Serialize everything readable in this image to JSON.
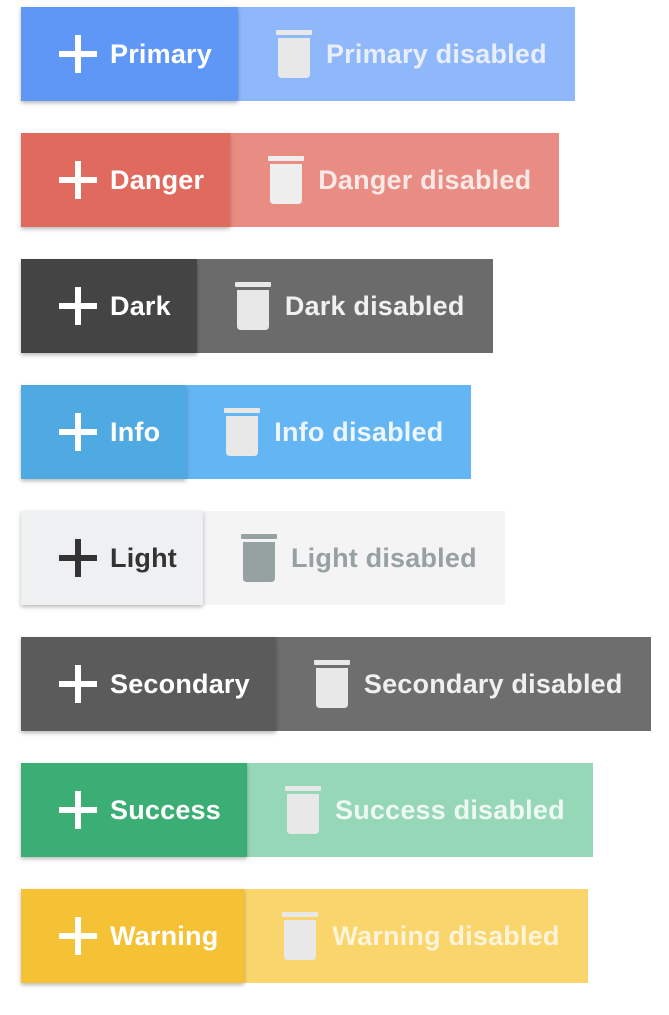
{
  "buttons": [
    {
      "id": "primary",
      "label": "Primary",
      "disabled_label": "Primary disabled",
      "colors": {
        "bg": "#5e97f6",
        "fg": "#ffffff",
        "disabled_bg": "#8fb8fa",
        "disabled_fg": "#e8eefb",
        "disabled_icon": "#e8e8e8"
      },
      "icon": "plus-icon",
      "disabled_icon": "trash-icon"
    },
    {
      "id": "danger",
      "label": "Danger",
      "disabled_label": "Danger disabled",
      "colors": {
        "bg": "#e06a5d",
        "fg": "#ffffff",
        "disabled_bg": "#e98c83",
        "disabled_fg": "#f8e9e7",
        "disabled_icon": "#eeeeee"
      },
      "icon": "plus-icon",
      "disabled_icon": "trash-icon"
    },
    {
      "id": "dark",
      "label": "Dark",
      "disabled_label": "Dark disabled",
      "colors": {
        "bg": "#444444",
        "fg": "#ffffff",
        "disabled_bg": "#6b6b6b",
        "disabled_fg": "#f0f0f0",
        "disabled_icon": "#e8e8e8"
      },
      "icon": "plus-icon",
      "disabled_icon": "trash-icon"
    },
    {
      "id": "info",
      "label": "Info",
      "disabled_label": "Info disabled",
      "colors": {
        "bg": "#4faae2",
        "fg": "#ffffff",
        "disabled_bg": "#64b5f3",
        "disabled_fg": "#eef6fd",
        "disabled_icon": "#e8e8e8"
      },
      "icon": "plus-icon",
      "disabled_icon": "trash-icon"
    },
    {
      "id": "light",
      "label": "Light",
      "disabled_label": "Light disabled",
      "colors": {
        "bg": "#eff0f2",
        "fg": "#333333",
        "disabled_bg": "#f4f4f4",
        "disabled_fg": "#97a1a3",
        "disabled_icon": "#96a2a2"
      },
      "icon": "plus-icon",
      "disabled_icon": "trash-icon"
    },
    {
      "id": "secondary",
      "label": "Secondary",
      "disabled_label": "Secondary disabled",
      "colors": {
        "bg": "#5b5b5b",
        "fg": "#ffffff",
        "disabled_bg": "#6e6e6e",
        "disabled_fg": "#f0f0f0",
        "disabled_icon": "#e8e8e8"
      },
      "icon": "plus-icon",
      "disabled_icon": "trash-icon"
    },
    {
      "id": "success",
      "label": "Success",
      "disabled_label": "Success disabled",
      "colors": {
        "bg": "#3aae75",
        "fg": "#ffffff",
        "disabled_bg": "#96d7b8",
        "disabled_fg": "#eef8f3",
        "disabled_icon": "#e8e8e8"
      },
      "icon": "plus-icon",
      "disabled_icon": "trash-icon"
    },
    {
      "id": "warning",
      "label": "Warning",
      "disabled_label": "Warning disabled",
      "colors": {
        "bg": "#f5c235",
        "fg": "#ffffff",
        "disabled_bg": "#fad56c",
        "disabled_fg": "#fdf4da",
        "disabled_icon": "#e8e8e8"
      },
      "icon": "plus-icon",
      "disabled_icon": "trash-icon"
    }
  ]
}
